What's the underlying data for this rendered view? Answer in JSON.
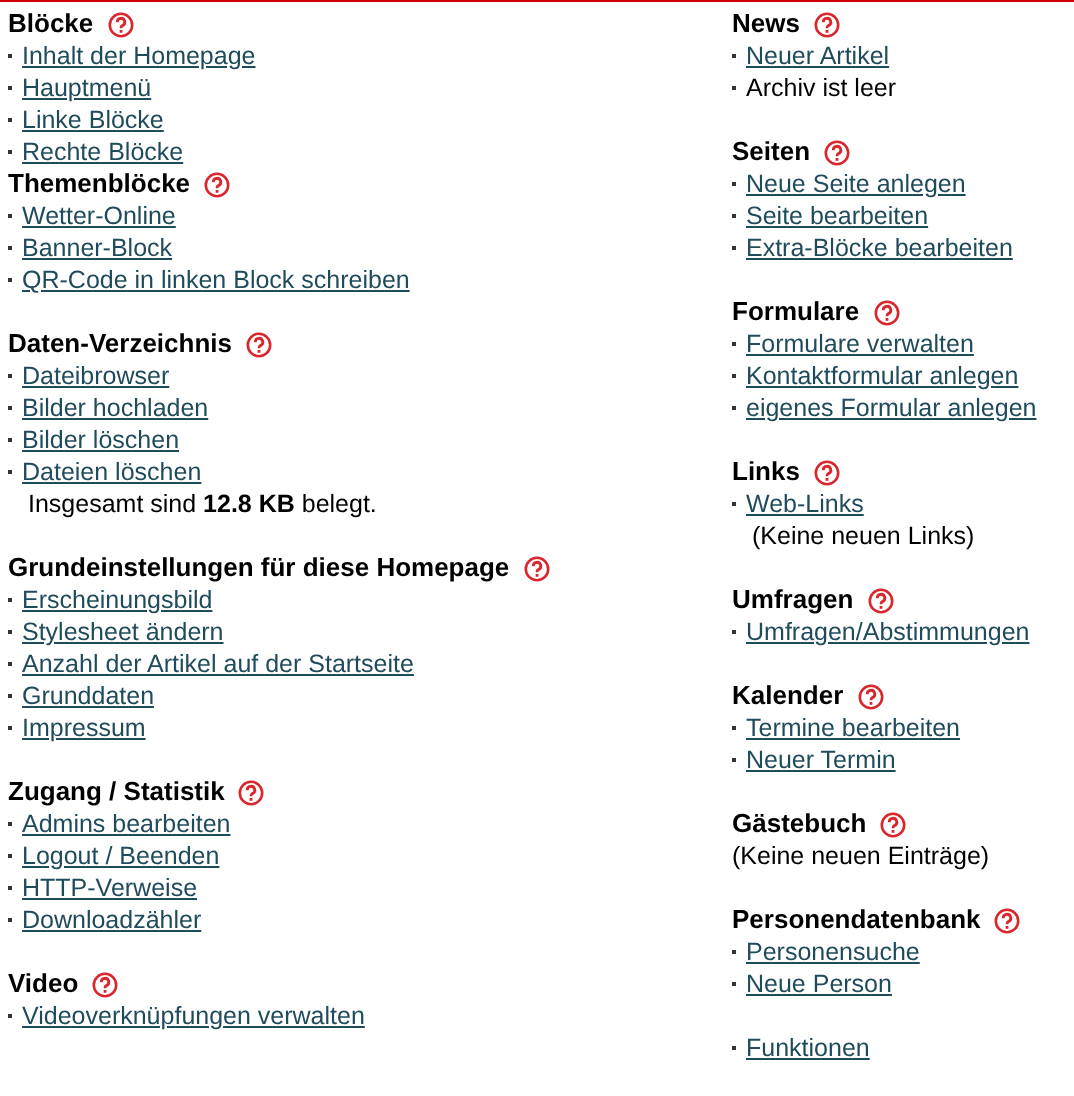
{
  "columns": [
    [
      [
        {
          "title": "Blöcke",
          "help": true,
          "items": [
            {
              "kind": "link",
              "text": "Inhalt der Homepage"
            },
            {
              "kind": "link",
              "text": "Hauptmenü"
            },
            {
              "kind": "link",
              "text": "Linke Blöcke"
            },
            {
              "kind": "link",
              "text": "Rechte Blöcke"
            }
          ]
        },
        {
          "title": "Themenblöcke",
          "help": true,
          "items": [
            {
              "kind": "link",
              "text": "Wetter-Online"
            },
            {
              "kind": "link",
              "text": "Banner-Block"
            },
            {
              "kind": "link",
              "text": "QR-Code in linken Block schreiben"
            }
          ]
        }
      ],
      [
        {
          "title": "Daten-Verzeichnis",
          "help": true,
          "items": [
            {
              "kind": "link",
              "text": "Dateibrowser"
            },
            {
              "kind": "link",
              "text": "Bilder hochladen"
            },
            {
              "kind": "link",
              "text": "Bilder löschen"
            },
            {
              "kind": "link",
              "text": "Dateien löschen"
            },
            {
              "kind": "note",
              "text": "Insgesamt sind **12.8 KB** belegt."
            }
          ]
        }
      ],
      [
        {
          "title": "Grundeinstellungen für diese Homepage",
          "help": true,
          "items": [
            {
              "kind": "link",
              "text": "Erscheinungsbild"
            },
            {
              "kind": "link",
              "text": "Stylesheet ändern"
            },
            {
              "kind": "link",
              "text": "Anzahl der Artikel auf der Startseite"
            },
            {
              "kind": "link",
              "text": "Grunddaten"
            },
            {
              "kind": "link",
              "text": "Impressum"
            }
          ]
        }
      ],
      [
        {
          "title": "Zugang / Statistik",
          "help": true,
          "items": [
            {
              "kind": "link",
              "text": "Admins bearbeiten"
            },
            {
              "kind": "link",
              "text": "Logout / Beenden"
            },
            {
              "kind": "link",
              "text": "HTTP-Verweise"
            },
            {
              "kind": "link",
              "text": "Downloadzähler"
            }
          ]
        }
      ],
      [
        {
          "title": "Video",
          "help": true,
          "items": [
            {
              "kind": "link",
              "text": "Videoverknüpfungen verwalten"
            }
          ]
        }
      ]
    ],
    [
      [
        {
          "title": "News",
          "help": true,
          "items": [
            {
              "kind": "link",
              "text": "Neuer Artikel"
            },
            {
              "kind": "text",
              "text": "Archiv ist leer"
            }
          ]
        }
      ],
      [
        {
          "title": "Seiten",
          "help": true,
          "items": [
            {
              "kind": "link",
              "text": "Neue Seite anlegen"
            },
            {
              "kind": "link",
              "text": "Seite bearbeiten"
            },
            {
              "kind": "link",
              "text": "Extra-Blöcke bearbeiten"
            }
          ]
        }
      ],
      [
        {
          "title": "Formulare",
          "help": true,
          "items": [
            {
              "kind": "link",
              "text": "Formulare verwalten"
            },
            {
              "kind": "link",
              "text": "Kontaktformular anlegen"
            },
            {
              "kind": "link",
              "text": "eigenes Formular anlegen"
            }
          ]
        }
      ],
      [
        {
          "title": "Links",
          "help": true,
          "items": [
            {
              "kind": "link",
              "text": "Web-Links"
            },
            {
              "kind": "note",
              "text": "(Keine neuen Links)"
            }
          ]
        }
      ],
      [
        {
          "title": "Umfragen",
          "help": true,
          "items": [
            {
              "kind": "link",
              "text": "Umfragen/Abstimmungen"
            }
          ]
        }
      ],
      [
        {
          "title": "Kalender",
          "help": true,
          "items": [
            {
              "kind": "link",
              "text": "Termine bearbeiten"
            },
            {
              "kind": "link",
              "text": "Neuer Termin"
            }
          ]
        }
      ],
      [
        {
          "title": "Gästebuch",
          "help": true,
          "items": [
            {
              "kind": "plain",
              "text": "(Keine neuen Einträge)"
            }
          ]
        }
      ],
      [
        {
          "title": "Personendatenbank",
          "help": true,
          "items": [
            {
              "kind": "link",
              "text": "Personensuche"
            },
            {
              "kind": "link",
              "text": "Neue Person"
            }
          ]
        }
      ],
      [
        {
          "items": [
            {
              "kind": "link",
              "text": "Funktionen"
            }
          ]
        }
      ]
    ]
  ]
}
